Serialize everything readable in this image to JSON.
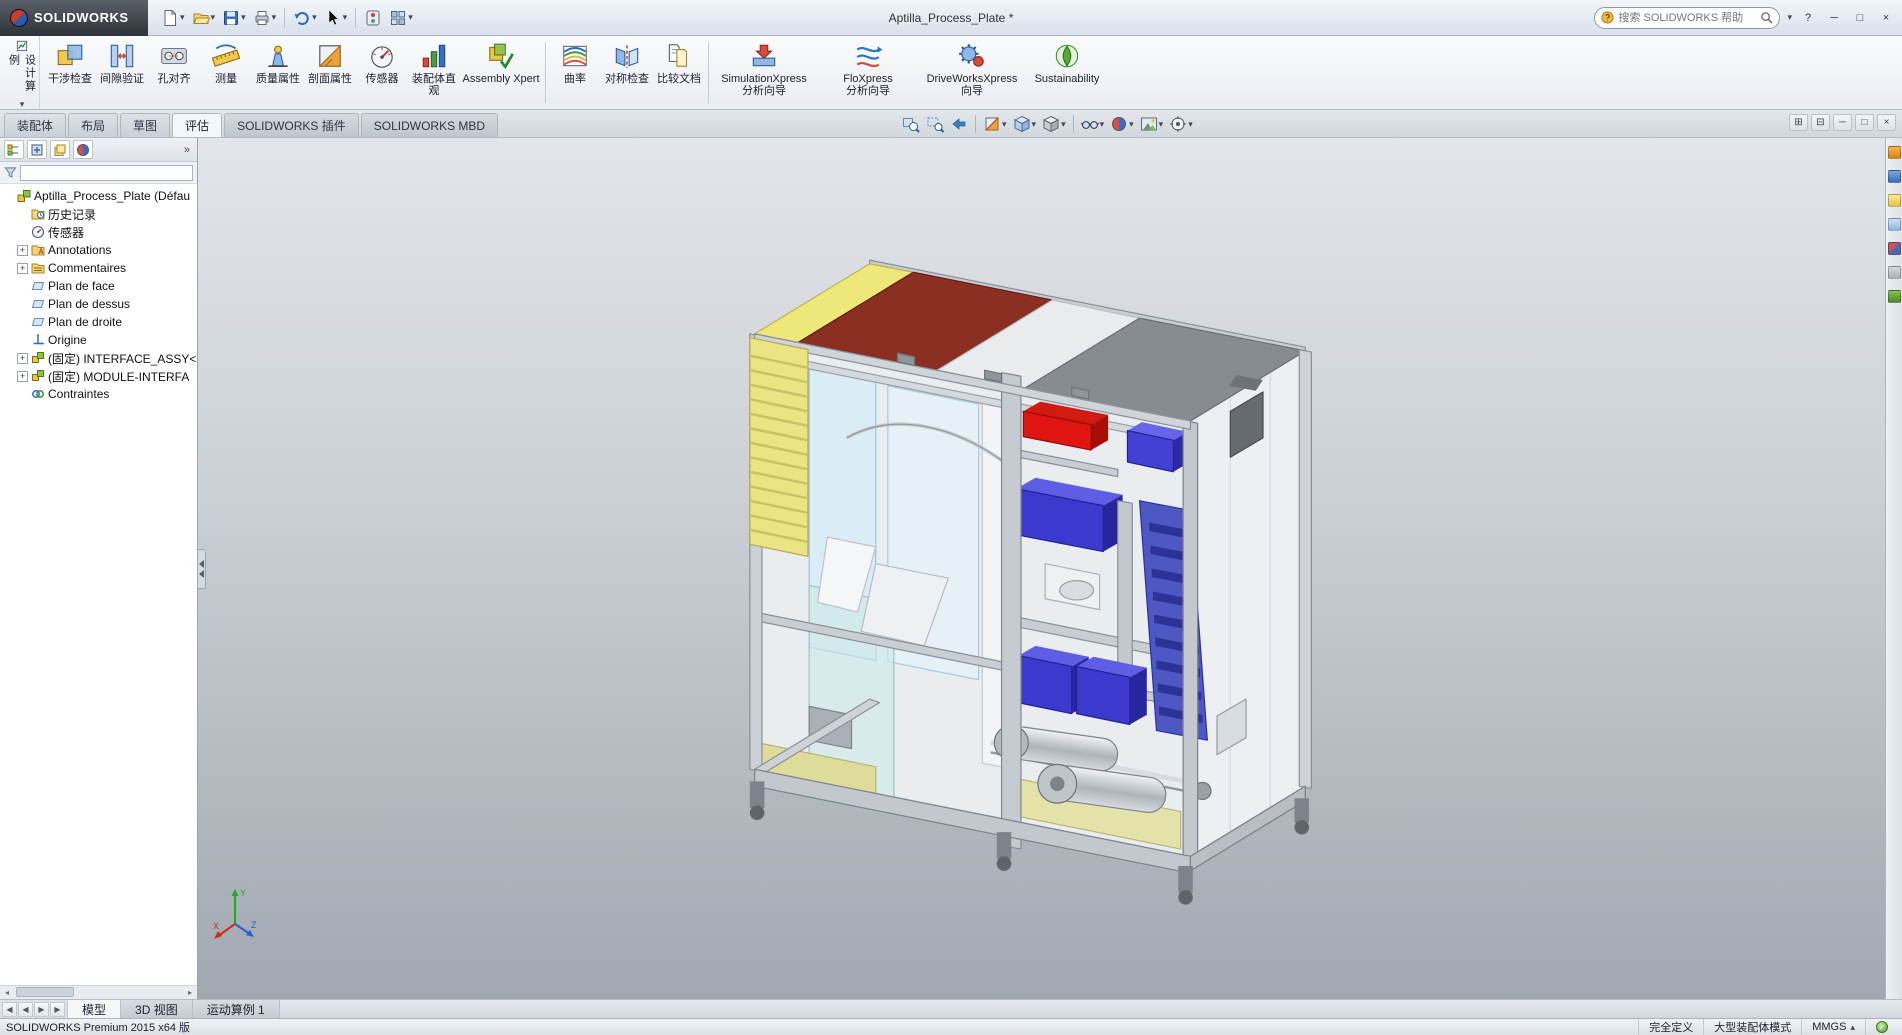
{
  "glyphs": {
    "chevron_down": "▾",
    "chevron_up": "▴",
    "expand_all": "»",
    "plus": "+",
    "help": "?",
    "minimize": "─",
    "maximize": "□",
    "close": "×",
    "pane_left": "⊞",
    "pane_right": "⊟",
    "nav_first": "◀",
    "nav_prev": "◀",
    "nav_next": "▶",
    "nav_last": "▶",
    "scroll_left": "◂",
    "scroll_right": "▸",
    "check": "✓"
  },
  "title_bar": {
    "brand": "SOLIDWORKS",
    "document_title": "Aptilla_Process_Plate *",
    "search_placeholder": "搜索 SOLIDWORKS 帮助",
    "quick_tools": [
      "new-document",
      "open",
      "save",
      "print",
      "undo",
      "select",
      "rebuild",
      "options-grid"
    ]
  },
  "ribbon": {
    "design_study": "设计算例",
    "tools": [
      {
        "label": "干涉检查"
      },
      {
        "label": "间隙验证"
      },
      {
        "label": "孔对齐"
      },
      {
        "label": "测量"
      },
      {
        "label": "质量属性"
      },
      {
        "label": "剖面属性"
      },
      {
        "label": "传感器"
      },
      {
        "label": "装配体直观"
      },
      {
        "label": "Assembly Xpert"
      },
      {
        "label": "曲率"
      },
      {
        "label": "对称检查"
      },
      {
        "label": "比较文档"
      },
      {
        "label": "SimulationXpress\n分析向导"
      },
      {
        "label": "FloXpress\n分析向导"
      },
      {
        "label": "DriveWorksXpress\n向导"
      },
      {
        "label": "Sustainability"
      }
    ]
  },
  "command_tabs": {
    "items": [
      {
        "label": "装配体"
      },
      {
        "label": "布局"
      },
      {
        "label": "草图"
      },
      {
        "label": "评估"
      },
      {
        "label": "SOLIDWORKS 插件"
      },
      {
        "label": "SOLIDWORKS MBD"
      }
    ],
    "active": "评估"
  },
  "heads_up": {
    "tools": [
      "zoom-fit",
      "zoom-to-area",
      "previous-view",
      "section-view",
      "view-orientation",
      "display-style",
      "hide-show-items",
      "edit-appearance",
      "apply-scene",
      "view-settings"
    ]
  },
  "feature_tree": {
    "root": "Aptilla_Process_Plate (Défau",
    "items": [
      {
        "label": "历史记录"
      },
      {
        "label": "传感器"
      },
      {
        "label": "Annotations"
      },
      {
        "label": "Commentaires"
      },
      {
        "label": "Plan de face"
      },
      {
        "label": "Plan de dessus"
      },
      {
        "label": "Plan de droite"
      },
      {
        "label": "Origine"
      },
      {
        "label": "(固定) INTERFACE_ASSY<"
      },
      {
        "label": "(固定) MODULE-INTERFA"
      },
      {
        "label": "Contraintes"
      }
    ]
  },
  "task_pane": {
    "tabs": [
      "solidworks-resources",
      "design-library",
      "file-explorer",
      "view-palette",
      "appearances",
      "custom-properties",
      "forum"
    ]
  },
  "doc_tabs": {
    "items": [
      {
        "label": "模型"
      },
      {
        "label": "3D 视图"
      },
      {
        "label": "运动算例 1"
      }
    ],
    "active": "模型"
  },
  "status_bar": {
    "left": "SOLIDWORKS Premium 2015 x64 版",
    "defined_state": "完全定义",
    "assembly_mode": "大型装配体模式",
    "units": "MMGS"
  }
}
